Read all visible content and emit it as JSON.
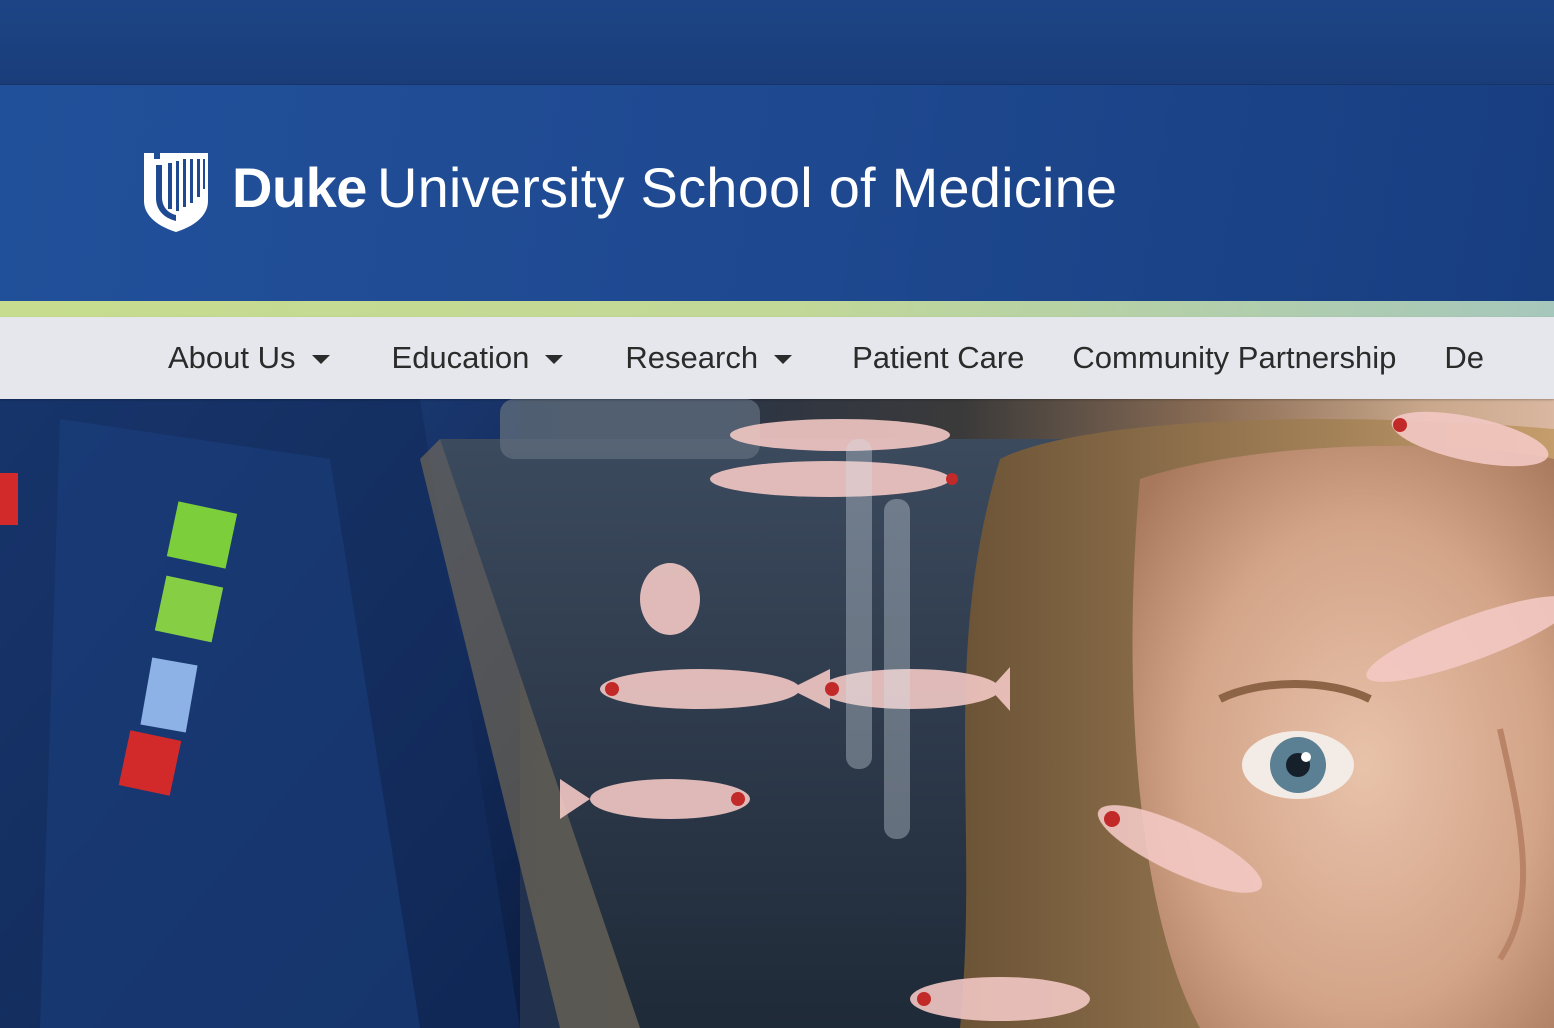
{
  "site": {
    "brand_bold": "Duke",
    "brand_rest": "University School of Medicine",
    "logo_icon": "duke-shield-icon"
  },
  "nav": {
    "items": [
      {
        "label": "About Us",
        "has_dropdown": true
      },
      {
        "label": "Education",
        "has_dropdown": true
      },
      {
        "label": "Research",
        "has_dropdown": true
      },
      {
        "label": "Patient Care",
        "has_dropdown": false
      },
      {
        "label": "Community Partnership",
        "has_dropdown": false
      },
      {
        "label": "De",
        "has_dropdown": false
      }
    ]
  },
  "colors": {
    "header_blue": "#1f4a92",
    "accent_green": "#c7dc8e",
    "nav_background": "#e6e7ec",
    "nav_text": "#2b2b2b"
  },
  "hero": {
    "subject": "researcher-with-zebrafish-tank"
  }
}
